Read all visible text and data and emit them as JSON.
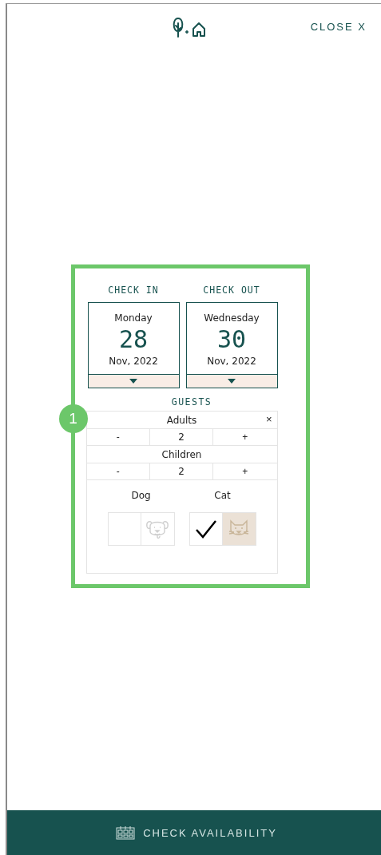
{
  "header": {
    "close": "CLOSE X"
  },
  "badge": "1",
  "dates": [
    {
      "label": "CHECK IN",
      "weekday": "Monday",
      "day": "28",
      "month_year": "Nov, 2022"
    },
    {
      "label": "CHECK OUT",
      "weekday": "Wednesday",
      "day": "30",
      "month_year": "Nov, 2022"
    }
  ],
  "guests": {
    "title": "GUESTS",
    "close": "×",
    "counters": [
      {
        "label": "Adults",
        "minus": "-",
        "value": "2",
        "plus": "+"
      },
      {
        "label": "Children",
        "minus": "-",
        "value": "2",
        "plus": "+"
      }
    ],
    "pets": [
      {
        "label": "Dog",
        "kind": "dog",
        "checked": false
      },
      {
        "label": "Cat",
        "kind": "cat",
        "checked": true
      }
    ]
  },
  "footer": {
    "button": "CHECK AVAILABILITY"
  }
}
